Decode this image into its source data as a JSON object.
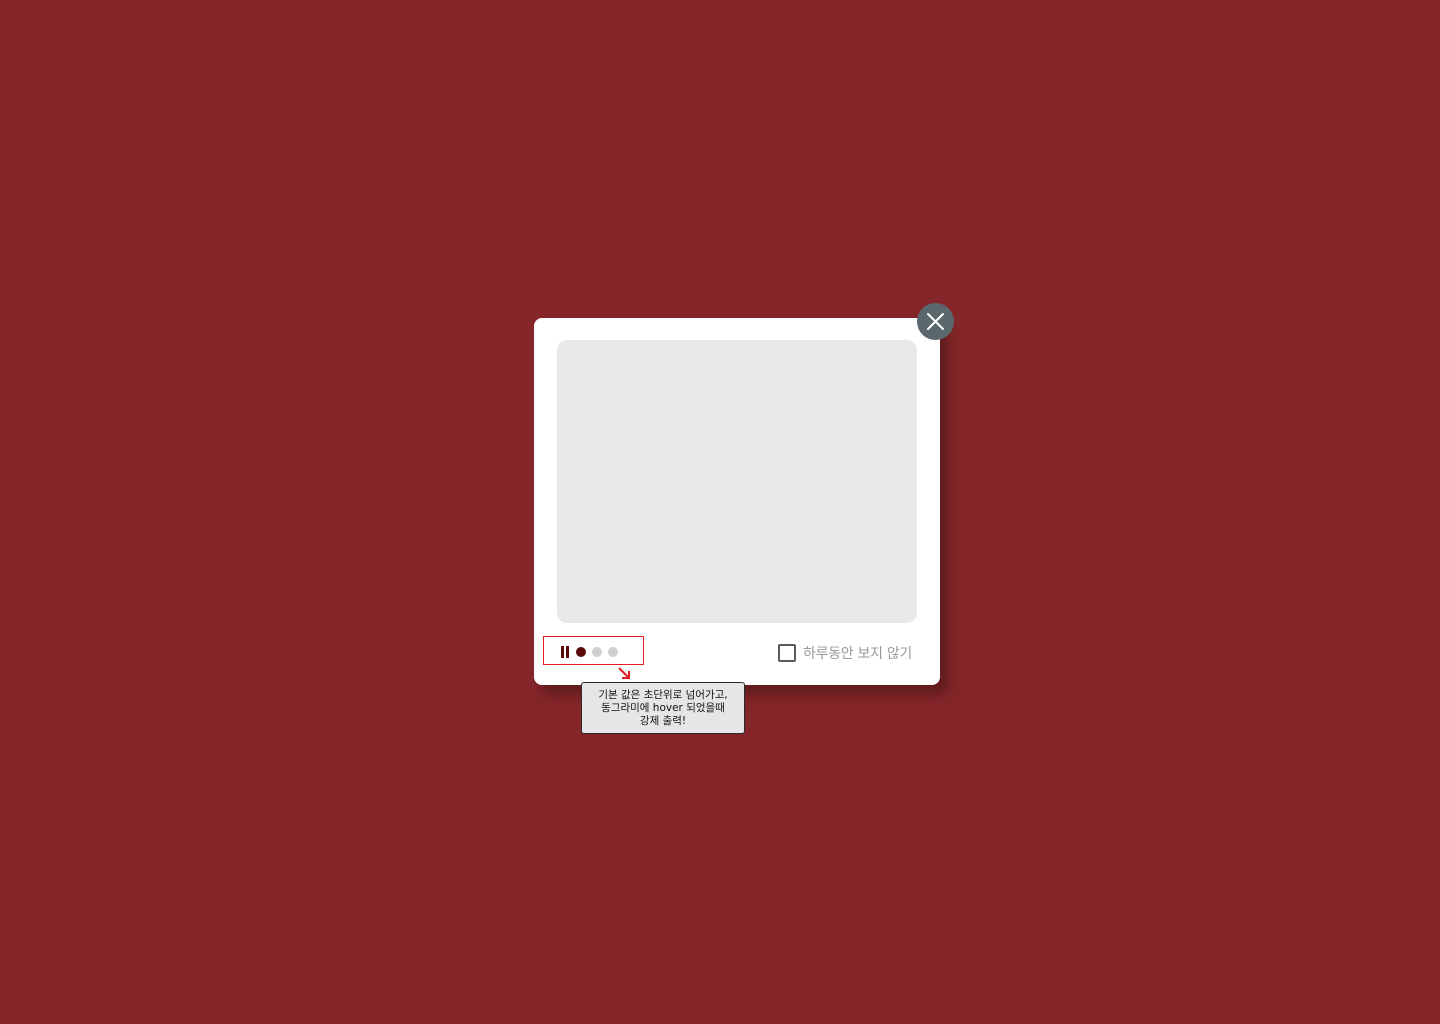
{
  "popup": {
    "hide_today_label": "하루동안 보지 않기",
    "hide_today_checked": false,
    "slider": {
      "total_slides": 3,
      "active_index": 0,
      "playing": true
    }
  },
  "annotation": {
    "lines": [
      "기본 값은 초단위로 넘어가고,",
      "동그라미에 hover 되었을때",
      "강제 출력!"
    ]
  },
  "colors": {
    "background": "#842629",
    "close_button": "#5a676d",
    "active_dot": "#5a0a0a",
    "inactive_dot": "#cfcfcf",
    "annotation_outline": "#e51c23"
  },
  "icons": {
    "close": "close-icon",
    "pause": "pause-icon",
    "arrow": "arrow-down-right-icon"
  }
}
